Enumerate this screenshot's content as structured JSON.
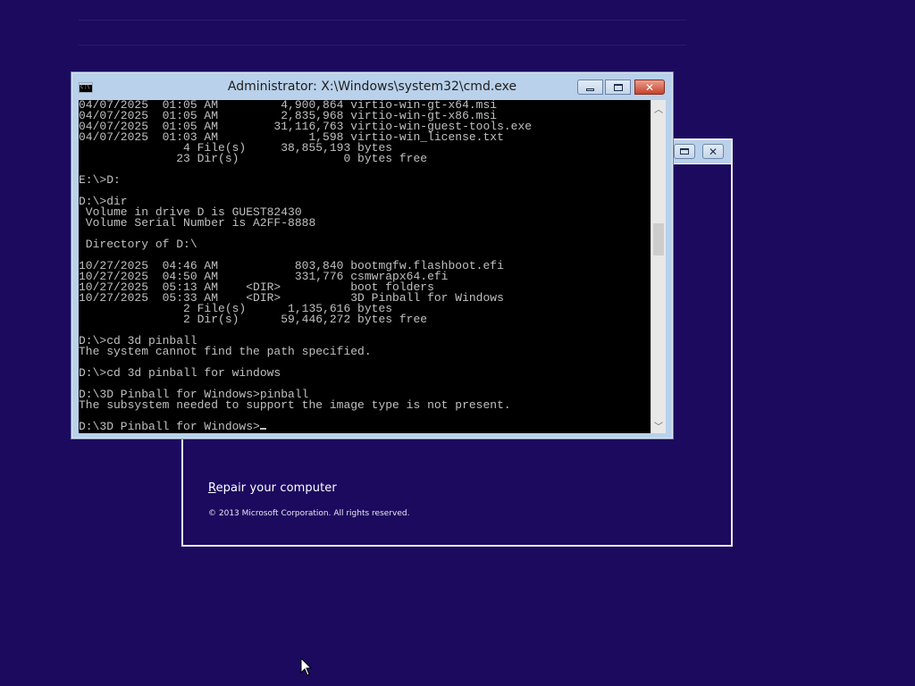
{
  "cmd": {
    "title": "Administrator: X:\\Windows\\system32\\cmd.exe",
    "icon": "cmd-icon",
    "lines": [
      "04/07/2025  01:05 AM         4,900,864 virtio-win-gt-x64.msi",
      "04/07/2025  01:05 AM         2,835,968 virtio-win-gt-x86.msi",
      "04/07/2025  01:05 AM        31,116,763 virtio-win-guest-tools.exe",
      "04/07/2025  01:03 AM             1,598 virtio-win_license.txt",
      "               4 File(s)     38,855,193 bytes",
      "              23 Dir(s)               0 bytes free",
      "",
      "E:\\>D:",
      "",
      "D:\\>dir",
      " Volume in drive D is GUEST82430",
      " Volume Serial Number is A2FF-8888",
      "",
      " Directory of D:\\",
      "",
      "10/27/2025  04:46 AM           803,840 bootmgfw.flashboot.efi",
      "10/27/2025  04:50 AM           331,776 csmwrapx64.efi",
      "10/27/2025  05:13 AM    <DIR>          boot folders",
      "10/27/2025  05:33 AM    <DIR>          3D Pinball for Windows",
      "               2 File(s)      1,135,616 bytes",
      "               2 Dir(s)      59,446,272 bytes free",
      "",
      "D:\\>cd 3d pinball",
      "The system cannot find the path specified.",
      "",
      "D:\\>cd 3d pinball for windows",
      "",
      "D:\\3D Pinball for Windows>pinball",
      "The subsystem needed to support the image type is not present.",
      ""
    ],
    "prompt": "D:\\3D Pinball for Windows>",
    "window_buttons": {
      "minimize": "minimize-icon",
      "maximize": "maximize-icon",
      "close": "close-icon"
    }
  },
  "setup": {
    "repair_link_first": "R",
    "repair_link_rest": "epair your computer",
    "copyright": "© 2013 Microsoft Corporation. All rights reserved."
  },
  "colors": {
    "desktop": "#1c0a5f",
    "titlebar": "#b9d1ea",
    "console_bg": "#000000",
    "console_fg": "#c0c0c0",
    "close_button": "#c7432b"
  }
}
